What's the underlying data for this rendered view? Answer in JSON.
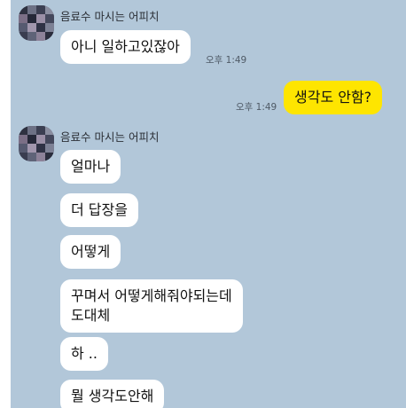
{
  "chat": {
    "sender_name": "음료수 마시는 어피치",
    "groups": [
      {
        "sender": "음료수 마시는 어피치",
        "messages": [
          "아니 일하고있잖아"
        ],
        "time": "오후 1:49"
      },
      {
        "mine": true,
        "messages": [
          "생각도 안함?"
        ],
        "time": "오후 1:49"
      },
      {
        "sender": "음료수 마시는 어피치",
        "messages": [
          "얼마나",
          "더 답장을",
          "어떻게",
          [
            "꾸며서 어떻게해줘야되는데",
            "도대체"
          ],
          "하 ..",
          "뭘 생각도안해"
        ]
      }
    ]
  },
  "colors": {
    "background": "#b2c7d9",
    "incoming_bubble": "#ffffff",
    "outgoing_bubble": "#fee500"
  }
}
